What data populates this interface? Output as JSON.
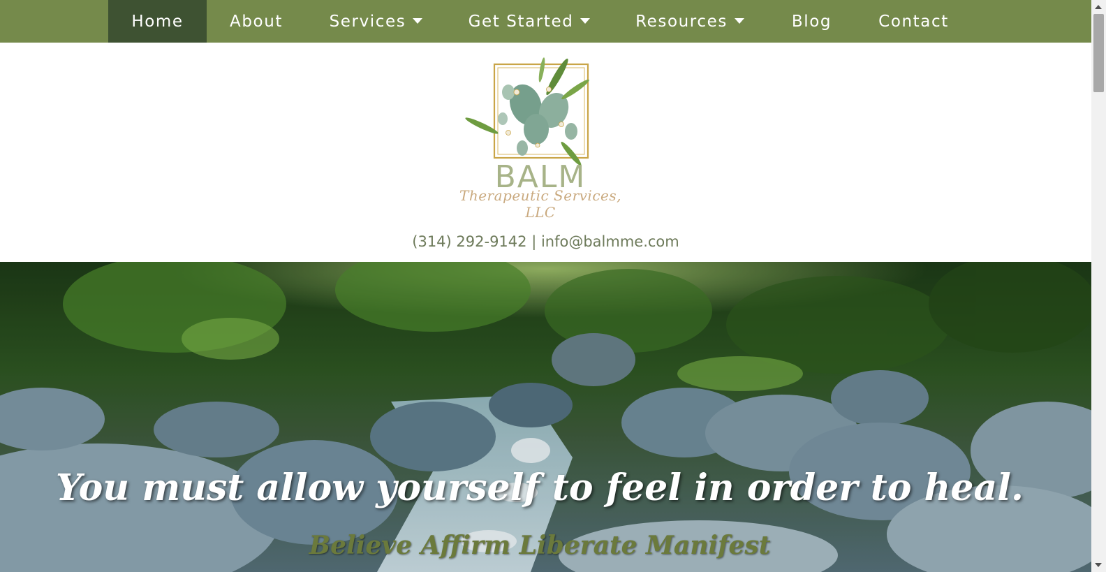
{
  "nav": {
    "items": [
      {
        "label": "Home",
        "active": true,
        "dropdown": false
      },
      {
        "label": "About",
        "active": false,
        "dropdown": false
      },
      {
        "label": "Services",
        "active": false,
        "dropdown": true
      },
      {
        "label": "Get Started",
        "active": false,
        "dropdown": true
      },
      {
        "label": "Resources",
        "active": false,
        "dropdown": true
      },
      {
        "label": "Blog",
        "active": false,
        "dropdown": false
      },
      {
        "label": "Contact",
        "active": false,
        "dropdown": false
      }
    ]
  },
  "logo": {
    "name": "BALM",
    "subtitle": "Therapeutic Services, LLC",
    "icon": "eucalyptus-frame-logo"
  },
  "contact": {
    "phone": "(314) 292-9142",
    "separator": " | ",
    "email": "info@balmme.com"
  },
  "hero": {
    "image": "forest-stream-rocks",
    "quote": "You must allow yourself to feel in order to heal.",
    "tagline": "Believe Affirm Liberate Manifest"
  },
  "colors": {
    "nav_bg": "#758a4b",
    "nav_active": "#3e5232",
    "contact_text": "#6d7a5a",
    "tagline": "#6b7a3c"
  }
}
